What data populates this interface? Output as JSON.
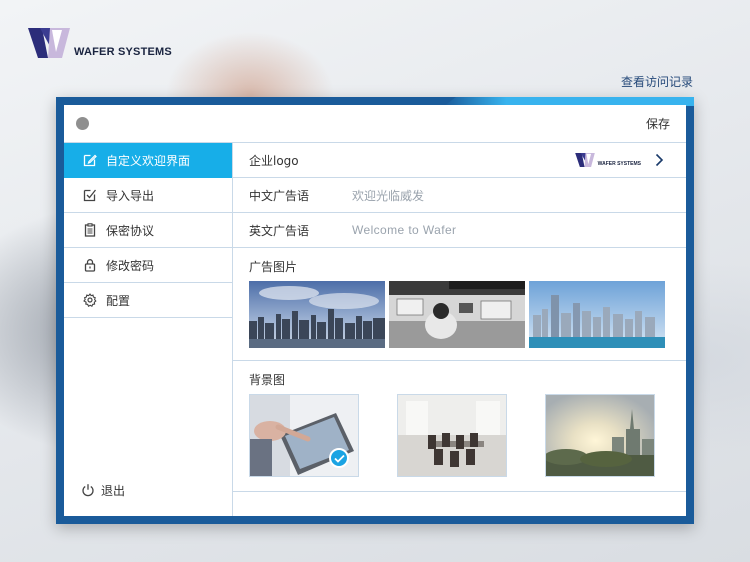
{
  "brand": {
    "name": "WAFER SYSTEMS",
    "icon": "wafer-logo"
  },
  "header": {
    "history_link": "查看访问记录"
  },
  "toolbar": {
    "save_label": "保存",
    "status_dot_color": "#8f8f8f"
  },
  "sidebar": {
    "items": [
      {
        "label": "自定义欢迎界面",
        "icon": "edit-icon",
        "active": true
      },
      {
        "label": "导入导出",
        "icon": "checkbox-edit-icon",
        "active": false
      },
      {
        "label": "保密协议",
        "icon": "document-icon",
        "active": false
      },
      {
        "label": "修改密码",
        "icon": "lock-icon",
        "active": false
      },
      {
        "label": "配置",
        "icon": "gear-icon",
        "active": false
      }
    ],
    "logout_label": "退出",
    "active_color": "#17aee8"
  },
  "settings": {
    "logo_row": {
      "label": "企业logo",
      "logo_text": "WAFER SYSTEMS"
    },
    "cn_slogan": {
      "label": "中文广告语",
      "value": "欢迎光临威发"
    },
    "en_slogan": {
      "label": "英文广告语",
      "value": "Welcome to Wafer"
    },
    "ad_images": {
      "title": "广告图片",
      "items": [
        "city-skyline-image",
        "office-desk-image",
        "waterfront-city-image"
      ]
    },
    "backgrounds": {
      "title": "背景图",
      "items": [
        {
          "name": "tablet-hand-image",
          "selected": true
        },
        {
          "name": "meeting-room-image",
          "selected": false
        },
        {
          "name": "city-sunset-image",
          "selected": false
        }
      ]
    }
  },
  "colors": {
    "frame": "#1a5b9a",
    "accent": "#38b3ee",
    "divider": "#c9d9e8"
  }
}
